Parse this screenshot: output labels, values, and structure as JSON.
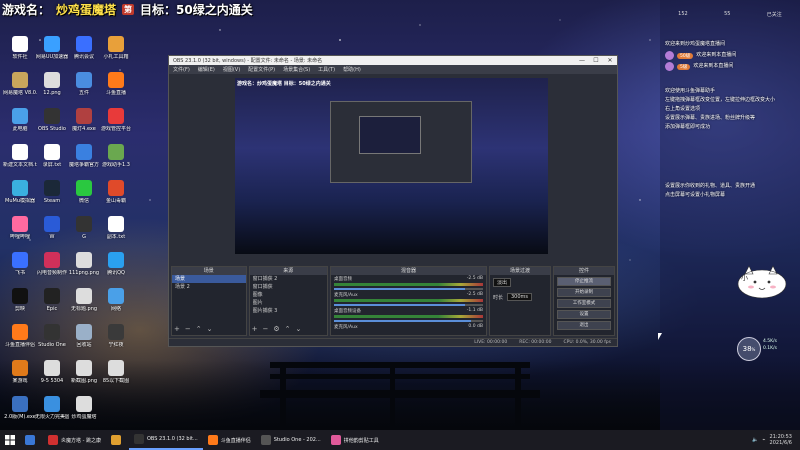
{
  "banner": {
    "game_label": "游戏名：",
    "game_name": "炒鸡蛋魔塔",
    "tag": "第",
    "goal": "目标：50绿之内通关"
  },
  "desktop_icons": [
    {
      "label": "软件社",
      "color": "#ffffff"
    },
    {
      "label": "网易UU加速器",
      "color": "#3aa0ff"
    },
    {
      "label": "腾讯会议",
      "color": "#3a6fff"
    },
    {
      "label": "小札工具箱",
      "color": "#e8a03a"
    },
    {
      "label": "网易魔塔 V8.0.zip",
      "color": "#c9a65c"
    },
    {
      "label": "12.png",
      "color": "#dddddd"
    },
    {
      "label": "五件",
      "color": "#4a8de0"
    },
    {
      "label": "斗鱼直播",
      "color": "#ff7a1a"
    },
    {
      "label": "此电脑",
      "color": "#4aa0e8"
    },
    {
      "label": "OBS Studio",
      "color": "#333333"
    },
    {
      "label": "魔灯4.exe",
      "color": "#b04040"
    },
    {
      "label": "游戏管控平台",
      "color": "#e83a3a"
    },
    {
      "label": "新建文本文档.txt",
      "color": "#ffffff"
    },
    {
      "label": "录屏.txt",
      "color": "#ffffff"
    },
    {
      "label": "魔塔争霸官方",
      "color": "#3a80e0"
    },
    {
      "label": "游戏助手1.3",
      "color": "#6aa84f"
    },
    {
      "label": "MuMu模拟器",
      "color": "#3ab0e0"
    },
    {
      "label": "Steam",
      "color": "#1b2838"
    },
    {
      "label": "微信",
      "color": "#2ac840"
    },
    {
      "label": "金山毒霸",
      "color": "#e04a2a"
    },
    {
      "label": "哔哩哔哩",
      "color": "#ff6aa0"
    },
    {
      "label": "W",
      "color": "#2a5bd7"
    },
    {
      "label": "G",
      "color": "#333333"
    },
    {
      "label": "副本.txt",
      "color": "#ffffff"
    },
    {
      "label": "飞书",
      "color": "#3a70ff"
    },
    {
      "label": "闪电音频制作",
      "color": "#d0305a"
    },
    {
      "label": "111png.png",
      "color": "#dddddd"
    },
    {
      "label": "腾讯QQ",
      "color": "#2aa0f0"
    },
    {
      "label": "剪映",
      "color": "#111111"
    },
    {
      "label": "Epic",
      "color": "#222222"
    },
    {
      "label": "无标题.png",
      "color": "#dddddd"
    },
    {
      "label": "网络",
      "color": "#4aa0e8"
    },
    {
      "label": "斗鱼直播伴侣",
      "color": "#ff7a1a"
    },
    {
      "label": "Studio One",
      "color": "#333333"
    },
    {
      "label": "回收站",
      "color": "#9ab0c8"
    },
    {
      "label": "宁红夜",
      "color": "#3a3a3a"
    },
    {
      "label": "某游戏",
      "color": "#e07a1a"
    },
    {
      "label": "9-5 5304",
      "color": "#dddddd"
    },
    {
      "label": "新截图.png",
      "color": "#dddddd"
    },
    {
      "label": "85以下截图",
      "color": "#dddddd"
    },
    {
      "label": "2.0版(M).exe",
      "color": "#3a70c0"
    },
    {
      "label": "无限火力完美圆形",
      "color": "#3a90e0"
    },
    {
      "label": "炒鸡蛋魔塔",
      "color": "#dddddd"
    }
  ],
  "obs": {
    "title": "OBS 23.1.0 (32 bit, windows) - 配置文件: 未命名 - 场景: 未命名",
    "menu": [
      "文件(F)",
      "编辑(E)",
      "视图(V)",
      "配置文件(P)",
      "场景集合(S)",
      "工具(T)",
      "帮助(H)"
    ],
    "preview_banner": "游戏名：炒鸡蛋魔塔  目标：50绿之内通关",
    "panels": {
      "scenes": {
        "title": "场景",
        "items": [
          "场景",
          "场景 2"
        ]
      },
      "sources": {
        "title": "来源",
        "items": [
          "窗口捕获 2",
          "窗口捕获",
          "图像",
          "图片",
          "图片捕获 3"
        ]
      },
      "mixer": {
        "title": "混音器",
        "rows": [
          {
            "name": "桌面音频",
            "db": "-2.5 dB"
          },
          {
            "name": "麦克风/Aux",
            "db": "-2.5 dB"
          },
          {
            "name": "桌面音频设备",
            "db": "-1.1 dB"
          },
          {
            "name": "麦克风/Aux",
            "db": "0.0 dB"
          }
        ]
      },
      "transitions": {
        "title": "场景过渡",
        "type": "淡出",
        "duration_label": "时长",
        "duration": "300ms"
      },
      "controls": {
        "title": "控件",
        "buttons": [
          "停止推流",
          "开始录制",
          "工作室模式",
          "设置",
          "退出"
        ]
      }
    },
    "status": {
      "live": "LIVE: 00:00:00",
      "rec": "REC: 00:00:00",
      "cpu": "CPU: 0.0%, 30.00 fps"
    }
  },
  "chat": {
    "stats": [
      "152",
      "55",
      "已关注"
    ],
    "messages": [
      "欢迎来到炒鸡蛋魔塔直播间",
      "欢迎使用斗鱼弹幕助手",
      "左键拖拽弹幕框改变位置，左键拉伸边框改变大小",
      "右上角设置选项",
      "设置展示弹幕、贵族进场、粉丝牌升级等",
      "添加弹幕框即可成功",
      "设置展示你收到的礼物、道具、贵族开通",
      "点击屏幕可设置小礼物屏幕"
    ],
    "gifts": [
      {
        "badge": "50级",
        "text": "欢迎来到本直播间"
      },
      {
        "badge": "5级",
        "text": "欢迎来到本直播间"
      }
    ]
  },
  "speed": {
    "value": "38",
    "unit": "%",
    "up": "4.5K/s",
    "down": "0.1K/s"
  },
  "taskbar": {
    "items": [
      {
        "label": "",
        "color": "#3a78d7"
      },
      {
        "label": "炎魔方塔 - 跳之康",
        "color": "#d03030"
      },
      {
        "label": "",
        "color": "#e0a030"
      },
      {
        "label": "OBS 23.1.0 (32 bit...",
        "color": "#333333"
      },
      {
        "label": "斗鱼直播伴侣",
        "color": "#ff7a1a"
      },
      {
        "label": "Studio One - 202...",
        "color": "#555555"
      },
      {
        "label": "拼他韵剪贴工具",
        "color": "#e05a9a"
      }
    ],
    "time": "21:20:53",
    "date": "2021/6/6"
  }
}
